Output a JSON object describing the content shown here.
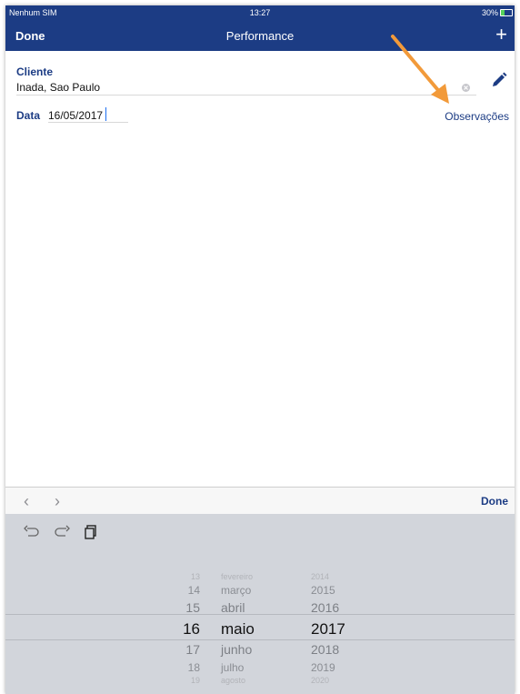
{
  "status_bar": {
    "carrier": "Nenhum SIM",
    "time": "13:27",
    "battery": "30%"
  },
  "navbar": {
    "done": "Done",
    "title": "Performance",
    "add": "+"
  },
  "form": {
    "cliente_label": "Cliente",
    "cliente_value": "Inada, Sao Paulo",
    "data_label": "Data",
    "data_value": "16/05/2017",
    "observacoes_link": "Observações"
  },
  "toolbar": {
    "prev": "‹",
    "next": "›",
    "done": "Done"
  },
  "picker": {
    "days": [
      "13",
      "14",
      "15",
      "16",
      "17",
      "18",
      "19"
    ],
    "months": [
      "fevereiro",
      "março",
      "abril",
      "maio",
      "junho",
      "julho",
      "agosto"
    ],
    "years": [
      "2014",
      "2015",
      "2016",
      "2017",
      "2018",
      "2019",
      "2020"
    ],
    "selected": {
      "day": "16",
      "month": "maio",
      "year": "2017"
    }
  },
  "colors": {
    "nav_bg": "#1c3c84",
    "accent": "#1c3c84",
    "annotation_arrow": "#f29a3a",
    "picker_bg": "#d2d5db"
  }
}
